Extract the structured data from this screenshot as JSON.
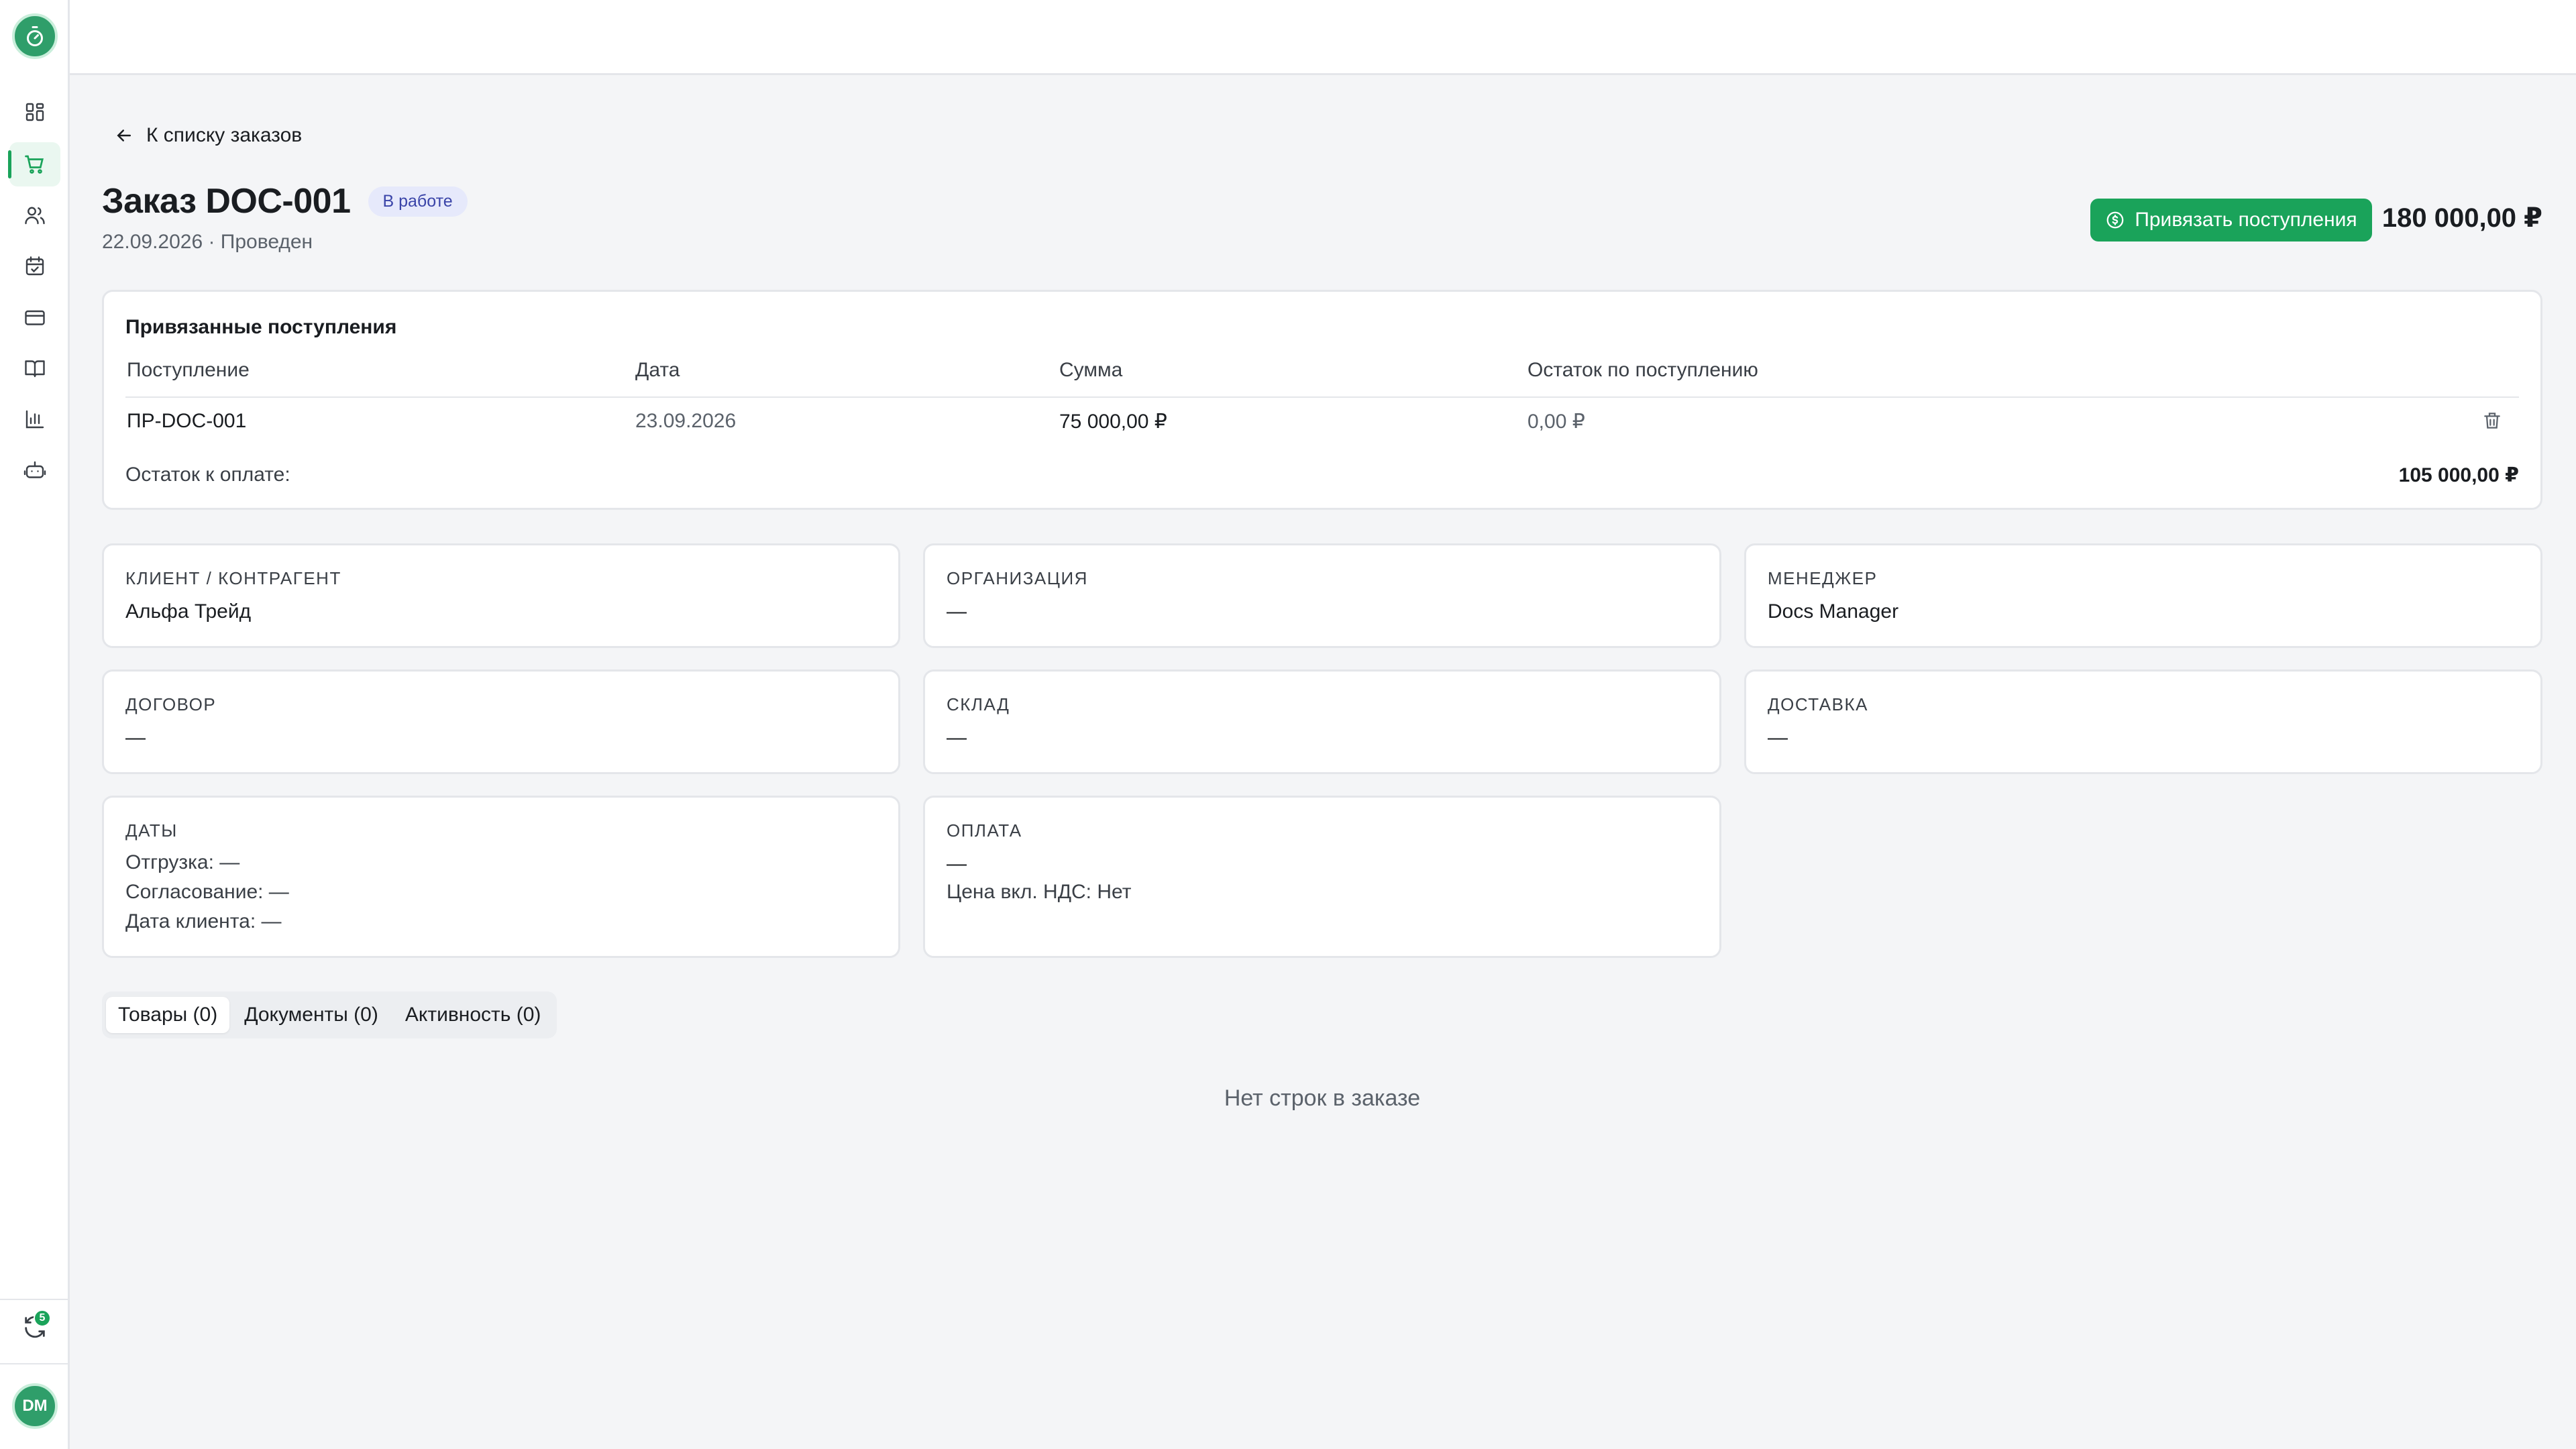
{
  "sidebar": {
    "nav": [
      {
        "icon": "dashboard-icon"
      },
      {
        "icon": "cart-icon",
        "active": true
      },
      {
        "icon": "users-icon"
      },
      {
        "icon": "calendar-check-icon"
      },
      {
        "icon": "credit-card-icon"
      },
      {
        "icon": "book-icon"
      },
      {
        "icon": "bar-chart-icon"
      },
      {
        "icon": "robot-icon"
      }
    ],
    "sync_badge": "5",
    "avatar_initials": "DM"
  },
  "header": {
    "back_label": "К списку заказов",
    "title": "Заказ DOC-001",
    "status_badge": "В работе",
    "subtitle": "22.09.2026 · Проведен",
    "link_button": "Привязать поступления",
    "total": "180 000,00 ₽"
  },
  "links": {
    "title": "Привязанные поступления",
    "columns": [
      "Поступление",
      "Дата",
      "Сумма",
      "Остаток по поступлению"
    ],
    "rows": [
      {
        "receipt": "ПР-DOC-001",
        "date": "23.09.2026",
        "amount": "75 000,00 ₽",
        "rest": "0,00 ₽"
      }
    ],
    "rest_label": "Остаток к оплате:",
    "rest_value": "105 000,00 ₽"
  },
  "info": {
    "client": {
      "label": "Клиент / контрагент",
      "value": "Альфа Трейд"
    },
    "organization": {
      "label": "Организация",
      "value": "—"
    },
    "manager": {
      "label": "Менеджер",
      "value": "Docs Manager"
    },
    "contract": {
      "label": "Договор",
      "value": "—"
    },
    "warehouse": {
      "label": "Склад",
      "value": "—"
    },
    "delivery": {
      "label": "Доставка",
      "value": "—"
    },
    "dates": {
      "label": "Даты",
      "lines": [
        "Отгрузка: —",
        "Согласование: —",
        "Дата клиента: —"
      ]
    },
    "payment": {
      "label": "Оплата",
      "value": "—",
      "vat": "Цена вкл. НДС: Нет"
    }
  },
  "tabs": [
    "Товары (0)",
    "Документы (0)",
    "Активность (0)"
  ],
  "empty_text": "Нет строк в заказе",
  "colors": {
    "accent": "#1aa35a",
    "badge_bg": "#e6e9fb",
    "badge_text": "#3a44a8"
  }
}
